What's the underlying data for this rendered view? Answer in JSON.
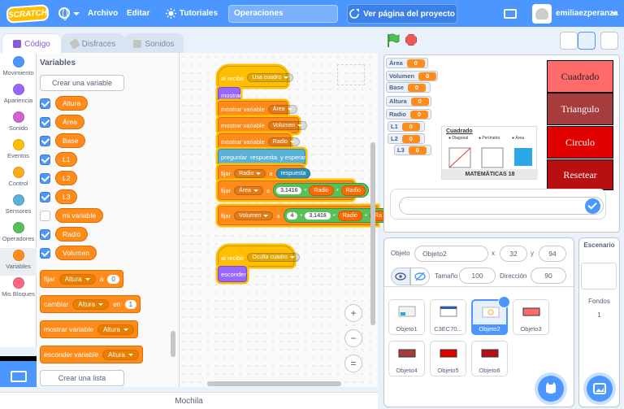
{
  "menubar": {
    "logo": "SCRATCH",
    "file": "Archivo",
    "edit": "Editar",
    "tutorials": "Tutoriales",
    "project_title": "Operaciones",
    "see_project": "Ver página del proyecto",
    "username": "emiliaezperanza"
  },
  "tabs": {
    "code": "Código",
    "costumes": "Disfraces",
    "sounds": "Sonidos"
  },
  "categories": [
    {
      "label": "Movimiento",
      "color": "#4c97ff"
    },
    {
      "label": "Apariencia",
      "color": "#9966ff"
    },
    {
      "label": "Sonido",
      "color": "#cf63cf"
    },
    {
      "label": "Eventos",
      "color": "#ffbf00"
    },
    {
      "label": "Control",
      "color": "#ffab19"
    },
    {
      "label": "Sensores",
      "color": "#5cb1d6"
    },
    {
      "label": "Operadores",
      "color": "#59c059"
    },
    {
      "label": "Variables",
      "color": "#ff8c1a"
    },
    {
      "label": "Mis Bloques",
      "color": "#ff6680"
    }
  ],
  "palette": {
    "title": "Variables",
    "make_variable": "Crear una variable",
    "make_list": "Crear una lista",
    "variables": [
      {
        "name": "Altura",
        "checked": true
      },
      {
        "name": "Área",
        "checked": true
      },
      {
        "name": "Base",
        "checked": true
      },
      {
        "name": "L1",
        "checked": true
      },
      {
        "name": "L2",
        "checked": true
      },
      {
        "name": "L3",
        "checked": true
      },
      {
        "name": "mi variable",
        "checked": false
      },
      {
        "name": "Radio",
        "checked": true
      },
      {
        "name": "Volumen",
        "checked": true
      }
    ],
    "blocks": {
      "set_label": "fijar",
      "set_var": "Altura",
      "set_to": "a",
      "set_value": "0",
      "change_label": "cambiar",
      "change_var": "Altura",
      "change_by": "en",
      "change_value": "1",
      "show_label": "mostrar variable",
      "show_var": "Altura",
      "hide_label": "esconder variable",
      "hide_var": "Altura"
    }
  },
  "script1": {
    "hat": "al recibir",
    "hat_msg": "Usa cuadro",
    "show": "mostrar",
    "showvar1": "mostrar variable",
    "showvar1_v": "Área",
    "showvar2": "mostrar variable",
    "showvar2_v": "Volumen",
    "showvar3": "mostrar variable",
    "showvar3_v": "Radio",
    "ask": "preguntar",
    "ask_q": "respuesta",
    "ask_wait": "y esperar",
    "set1": "fijar",
    "set1_var": "Radio",
    "set1_to": "a",
    "set1_val": "respuesta",
    "set2": "fijar",
    "set2_var": "Área",
    "set2_to": "a",
    "set2_num": "3.1416",
    "set2_mul": "*",
    "set2_r1": "Radio",
    "set2_mul2": "*",
    "set2_r2": "Radio",
    "set3": "fijar",
    "set3_var": "Volumen",
    "set3_to": "a",
    "set3_num1": "4",
    "set3_mul": "*",
    "set3_num2": "3.1416",
    "set3_mul2": "*",
    "set3_r1": "Radio",
    "set3_mul3": "*",
    "set3_r2": "Ra"
  },
  "script2": {
    "hat": "al recibir",
    "hat_msg": "Oculta cuadro",
    "hide": "esconder"
  },
  "backpack": "Mochila",
  "stage": {
    "monitors": [
      {
        "label": "Área",
        "value": "0"
      },
      {
        "label": "Volumen",
        "value": "0"
      },
      {
        "label": "Base",
        "value": "0"
      },
      {
        "label": "Altura",
        "value": "0"
      },
      {
        "label": "Radio",
        "value": "0"
      },
      {
        "label": "L1",
        "value": "0"
      },
      {
        "label": "L2",
        "value": "0"
      },
      {
        "label": "L3",
        "value": "0"
      }
    ],
    "buttons": [
      {
        "label": "Cuadrado",
        "bg": "#ff6b6b",
        "color": "#222"
      },
      {
        "label": "Triangulo",
        "bg": "#a63c3c",
        "color": "#fff"
      },
      {
        "label": "Circulo",
        "bg": "#e00000",
        "color": "#fff"
      },
      {
        "label": "Resetear",
        "bg": "#b81010",
        "color": "#fff"
      }
    ],
    "poster": {
      "title": "Cuadrado",
      "col1": "● Diagonal",
      "col2": "● Perímetro",
      "col3": "● Área",
      "footer": "MATEMÁTICAS 18"
    }
  },
  "sprite_info": {
    "sprite_label": "Objeto",
    "sprite_name": "Objeto2",
    "x_label": "x",
    "x": "32",
    "y_label": "y",
    "y": "94",
    "show_label": "Mostrar",
    "size_label": "Tamaño",
    "size": "100",
    "direction_label": "Dirección",
    "direction": "90"
  },
  "sprites": [
    {
      "name": "Objeto1",
      "selected": false
    },
    {
      "name": "C3EC70...",
      "selected": false
    },
    {
      "name": "Objeto2",
      "selected": true
    },
    {
      "name": "Objeto3",
      "selected": false
    },
    {
      "name": "Objeto4",
      "selected": false
    },
    {
      "name": "Objeto5",
      "selected": false
    },
    {
      "name": "Objeto6",
      "selected": false
    }
  ],
  "stage_selector": {
    "title": "Escenario",
    "backdrops_label": "Fondos",
    "backdrops_count": "1"
  }
}
